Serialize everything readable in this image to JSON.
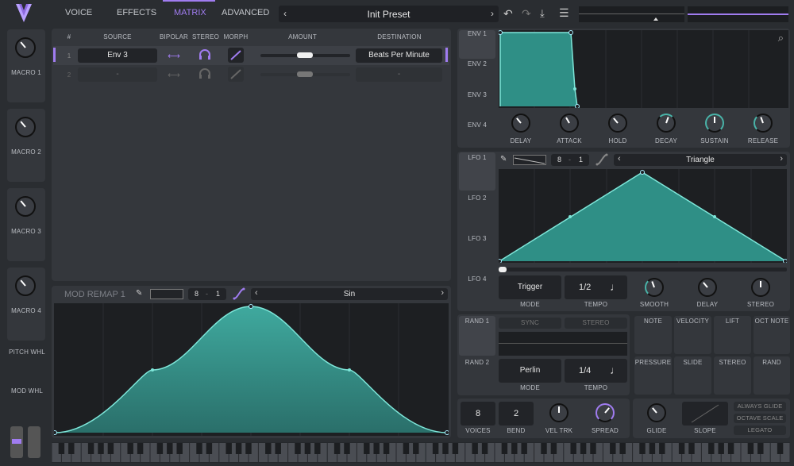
{
  "header": {
    "tabs": [
      {
        "label": "VOICE"
      },
      {
        "label": "EFFECTS"
      },
      {
        "label": "MATRIX"
      },
      {
        "label": "ADVANCED"
      }
    ],
    "preset_name": "Init Preset"
  },
  "macros": [
    {
      "label": "MACRO 1"
    },
    {
      "label": "MACRO 2"
    },
    {
      "label": "MACRO 3"
    },
    {
      "label": "MACRO 4"
    }
  ],
  "wheels": {
    "pitch": "PITCH WHL",
    "mod": "MOD WHL"
  },
  "matrix": {
    "headers": {
      "num": "#",
      "source": "SOURCE",
      "bipolar": "BIPOLAR",
      "stereo": "STEREO",
      "morph": "MORPH",
      "amount": "AMOUNT",
      "destination": "DESTINATION"
    },
    "rows": [
      {
        "num": "1",
        "source": "Env 3",
        "destination": "Beats Per Minute",
        "amount": 0.5
      },
      {
        "num": "2",
        "source": "-",
        "destination": "-",
        "amount": 0.5
      }
    ]
  },
  "mod_remap": {
    "title": "MOD REMAP 1",
    "grid_a": "8",
    "grid_b": "1",
    "shape": "Sin"
  },
  "env": {
    "tabs": [
      "ENV 1",
      "ENV 2",
      "ENV 3",
      "ENV 4"
    ],
    "knobs": [
      "DELAY",
      "ATTACK",
      "HOLD",
      "DECAY",
      "SUSTAIN",
      "RELEASE"
    ],
    "accent": "#49b3a8"
  },
  "lfo": {
    "tabs": [
      "LFO 1",
      "LFO 2",
      "LFO 3",
      "LFO 4"
    ],
    "grid_a": "8",
    "grid_b": "1",
    "shape": "Triangle",
    "trigger": "Trigger",
    "mode_label": "MODE",
    "tempo": "1/2",
    "tempo_label": "TEMPO",
    "knobs": [
      "SMOOTH",
      "DELAY",
      "STEREO"
    ]
  },
  "random": {
    "tabs": [
      "RAND 1",
      "RAND 2"
    ],
    "sync": "SYNC",
    "stereo": "STEREO",
    "style": "Perlin",
    "mode_label": "MODE",
    "tempo": "1/4",
    "tempo_label": "TEMPO"
  },
  "mod_sources": [
    "NOTE",
    "VELOCITY",
    "LIFT",
    "OCT NOTE",
    "PRESSURE",
    "SLIDE",
    "STEREO",
    "RAND"
  ],
  "voice": {
    "voices": "8",
    "voices_label": "VOICES",
    "bend": "2",
    "bend_label": "BEND",
    "vel_trk": "VEL TRK",
    "spread": "SPREAD",
    "glide": "GLIDE",
    "slope": "SLOPE",
    "always_glide": "ALWAYS GLIDE",
    "octave_scale": "OCTAVE SCALE",
    "legato": "LEGATO"
  },
  "colors": {
    "accent_purple": "#a07cf0",
    "teal": "#3aa79c"
  }
}
